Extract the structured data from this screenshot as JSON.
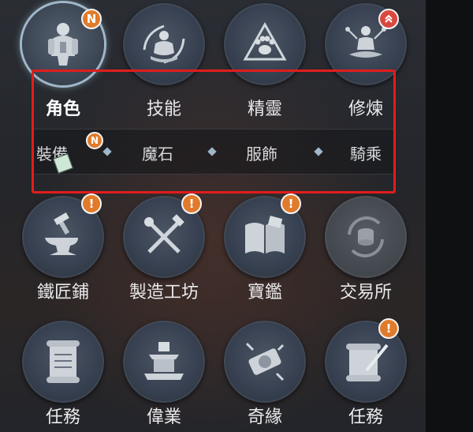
{
  "row1": [
    {
      "label": "角色",
      "icon": "knight-icon",
      "badge": "N",
      "active": true
    },
    {
      "label": "技能",
      "icon": "meditating-monk-icon",
      "badge": "",
      "active": false
    },
    {
      "label": "精靈",
      "icon": "paw-icon",
      "badge": "",
      "active": false
    },
    {
      "label": "修煉",
      "icon": "lotus-meditation-icon",
      "badge": "up",
      "active": false
    }
  ],
  "subtabs": [
    {
      "label": "裝備",
      "badge": "N"
    },
    {
      "label": "魔石"
    },
    {
      "label": "服飾"
    },
    {
      "label": "騎乘"
    }
  ],
  "row2": [
    {
      "label": "鐵匠鋪",
      "icon": "anvil-hammer-icon",
      "badge": "!"
    },
    {
      "label": "製造工坊",
      "icon": "crossed-tools-icon",
      "badge": "!"
    },
    {
      "label": "寶鑑",
      "icon": "open-book-icon",
      "badge": "!"
    },
    {
      "label": "交易所",
      "icon": "coin-exchange-icon",
      "badge": "",
      "disabled": true
    }
  ],
  "row3": [
    {
      "label": "任務",
      "icon": "scroll-icon",
      "badge": ""
    },
    {
      "label": "偉業",
      "icon": "temple-icon",
      "badge": ""
    },
    {
      "label": "奇緣",
      "icon": "sealed-scroll-icon",
      "badge": ""
    },
    {
      "label": "任務",
      "icon": "quill-scroll-icon",
      "badge": "!"
    }
  ],
  "colors": {
    "highlight": "#e11d1d",
    "badge": "#e07b2c",
    "badge_up": "#d9483f"
  }
}
